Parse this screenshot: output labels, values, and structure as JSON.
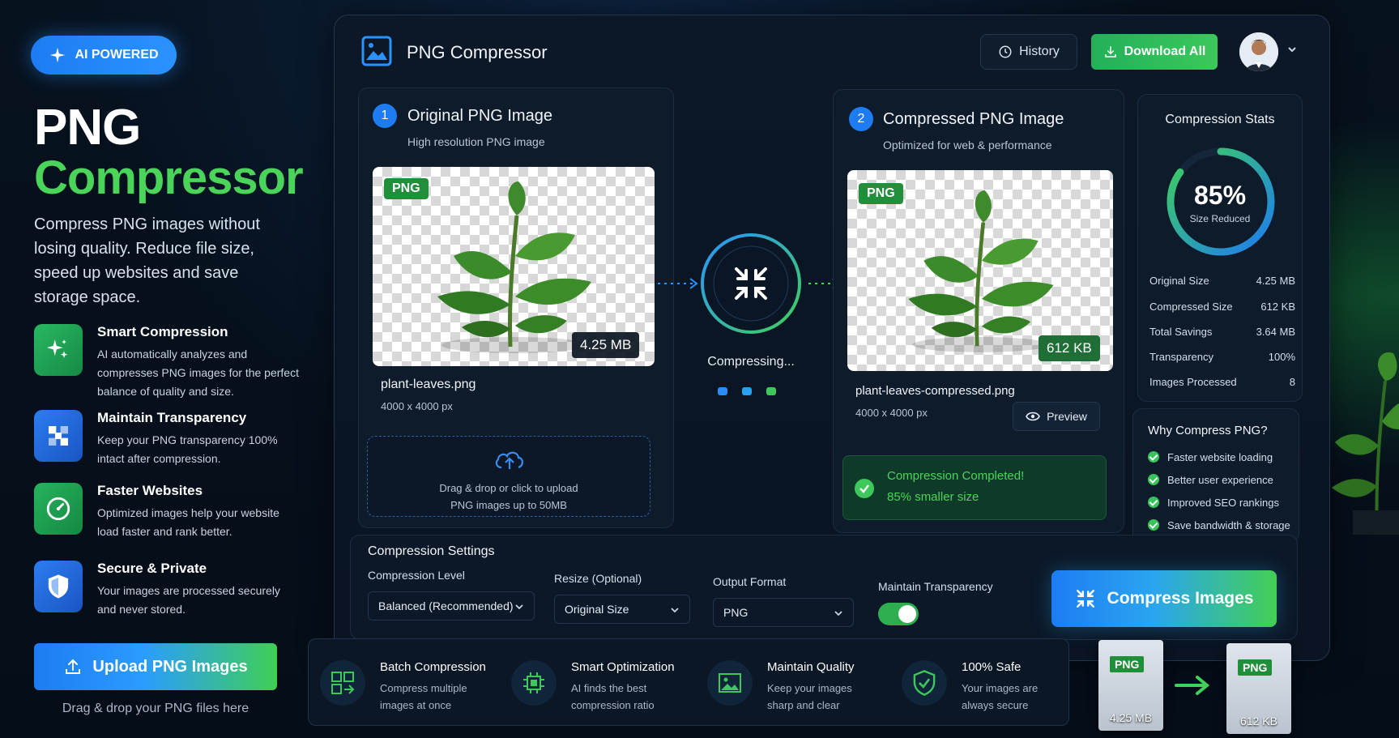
{
  "hero": {
    "badge": "AI POWERED",
    "title_line1": "PNG",
    "title_line2": "Compressor",
    "description": "Compress PNG images without losing quality. Reduce file size, speed up websites and save storage space.",
    "features": [
      {
        "title": "Smart Compression",
        "desc": "AI automatically analyzes and compresses PNG images for the perfect balance of quality and size.",
        "icon": "sparkles-icon"
      },
      {
        "title": "Maintain Transparency",
        "desc": "Keep your PNG transparency 100% intact after compression.",
        "icon": "grid-icon"
      },
      {
        "title": "Faster Websites",
        "desc": "Optimized images help your website load faster and rank better.",
        "icon": "speedometer-icon"
      },
      {
        "title": "Secure & Private",
        "desc": "Your images are processed securely and never stored.",
        "icon": "shield-icon"
      }
    ],
    "upload_button": "Upload PNG Images",
    "upload_hint": "Drag & drop your PNG files here"
  },
  "app": {
    "title": "PNG Compressor",
    "history_button": "History",
    "download_all_button": "Download All"
  },
  "original": {
    "step": "1",
    "title": "Original PNG Image",
    "subtitle": "High resolution PNG image",
    "tag": "PNG",
    "size": "4.25 MB",
    "filename": "plant-leaves.png",
    "dimensions": "4000 x 4000 px"
  },
  "dropzone": {
    "line1": "Drag & drop or click to upload",
    "line2": "PNG images up to 50MB"
  },
  "process": {
    "status": "Compressing..."
  },
  "compressed": {
    "step": "2",
    "title": "Compressed PNG Image",
    "subtitle": "Optimized for web & performance",
    "tag": "PNG",
    "size": "612 KB",
    "filename": "plant-leaves-compressed.png",
    "dimensions": "4000 x 4000 px",
    "preview_button": "Preview",
    "success_line1": "Compression Completed!",
    "success_line2": "85% smaller size"
  },
  "stats": {
    "title": "Compression Stats",
    "percent_label": "85%",
    "percent_value": 0.85,
    "percent_caption": "Size Reduced",
    "rows": [
      {
        "label": "Original Size",
        "value": "4.25 MB"
      },
      {
        "label": "Compressed Size",
        "value": "612 KB"
      },
      {
        "label": "Total Savings",
        "value": "3.64 MB"
      },
      {
        "label": "Transparency",
        "value": "100%"
      },
      {
        "label": "Images Processed",
        "value": "8"
      }
    ]
  },
  "why": {
    "title": "Why Compress PNG?",
    "items": [
      "Faster website loading",
      "Better user experience",
      "Improved SEO rankings",
      "Save bandwidth & storage"
    ]
  },
  "settings": {
    "title": "Compression Settings",
    "level_label": "Compression Level",
    "level_value": "Balanced (Recommended)",
    "resize_label": "Resize (Optional)",
    "resize_value": "Original Size",
    "format_label": "Output Format",
    "format_value": "PNG",
    "transparency_label": "Maintain Transparency",
    "transparency_on": true,
    "compress_button": "Compress Images"
  },
  "bottom_features": [
    {
      "title": "Batch Compression",
      "desc": "Compress multiple images at once",
      "icon": "batch-icon"
    },
    {
      "title": "Smart Optimization",
      "desc": "AI finds the best compression ratio",
      "icon": "chip-icon"
    },
    {
      "title": "Maintain Quality",
      "desc": "Keep your images sharp and clear",
      "icon": "image-icon"
    },
    {
      "title": "100% Safe",
      "desc": "Your images are always secure",
      "icon": "shield-check-icon"
    }
  ],
  "file_cards": {
    "before_tag": "PNG",
    "before_size": "4.25 MB",
    "after_tag": "PNG",
    "after_size": "612 KB"
  },
  "colors": {
    "accent_blue": "#1d7cf2",
    "accent_green": "#3cc85a",
    "panel_bg": "#0c1827"
  }
}
